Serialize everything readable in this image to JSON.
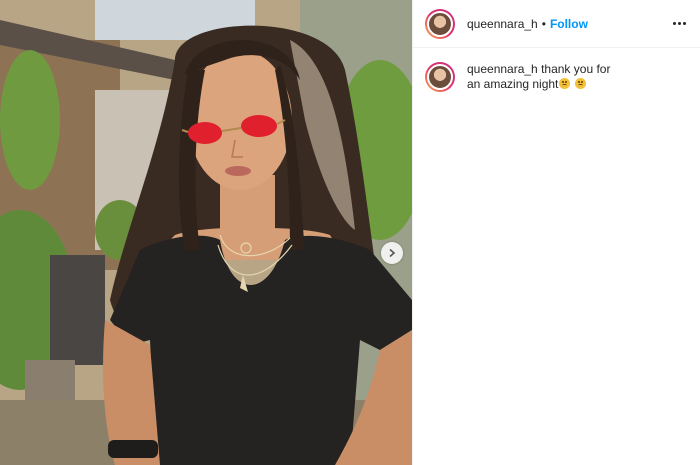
{
  "post": {
    "header": {
      "username": "queennara_h",
      "separator": "•",
      "follow_label": "Follow",
      "more_icon": "more-horizontal-icon"
    },
    "caption": {
      "username": "queennara_h",
      "text": "thank you for an amazing night",
      "emojis": [
        "pleading-face-emoji",
        "pleading-face-emoji"
      ]
    },
    "media": {
      "next_icon": "chevron-right-icon"
    }
  },
  "colors": {
    "follow": "#0095f6",
    "story_ring": "#e1306c",
    "text": "#262626"
  }
}
